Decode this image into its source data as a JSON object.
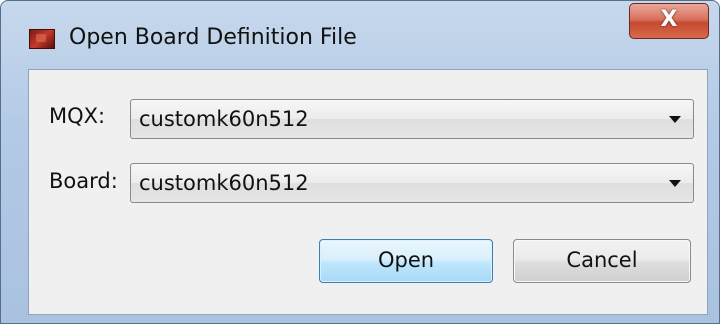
{
  "window": {
    "title": "Open Board Definition File",
    "close_glyph": "X"
  },
  "icons": {
    "app": "board-file-icon",
    "close": "close-icon",
    "dropdown": "chevron-down-icon"
  },
  "form": {
    "mqx": {
      "label": "MQX:",
      "value": "customk60n512"
    },
    "board": {
      "label": "Board:",
      "value": "customk60n512"
    }
  },
  "buttons": {
    "open_label": "Open",
    "cancel_label": "Cancel"
  },
  "colors": {
    "close_button": "#c54a30",
    "default_button_border": "#3c7fb1",
    "window_frame": "#b3cae6",
    "client_background": "#f0f0f0"
  }
}
